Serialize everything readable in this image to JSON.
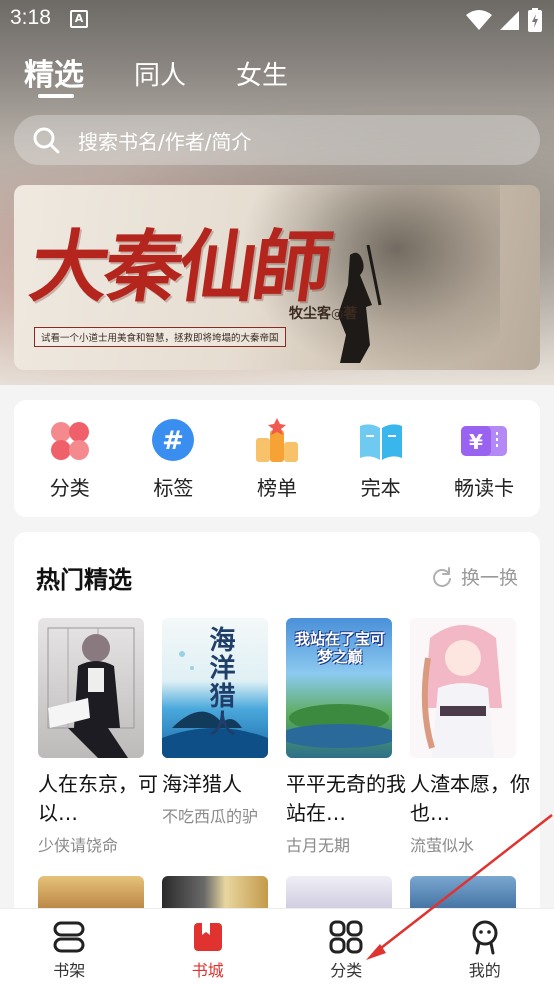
{
  "status_bar": {
    "time": "3:18",
    "indicator": "A"
  },
  "top_tabs": [
    {
      "label": "精选",
      "active": true
    },
    {
      "label": "同人",
      "active": false
    },
    {
      "label": "女生",
      "active": false
    }
  ],
  "search": {
    "placeholder": "搜索书名/作者/简介"
  },
  "banner": {
    "title": "大秦仙師",
    "author": "牧尘客◎著",
    "tagline": "试看一个小道士用美食和智慧，拯救即将垮塌的大秦帝国"
  },
  "categories": [
    {
      "label": "分类",
      "icon": "clover-icon",
      "color": "#f0606a"
    },
    {
      "label": "标签",
      "icon": "hashtag-icon",
      "color": "#3a8ef0"
    },
    {
      "label": "榜单",
      "icon": "podium-icon",
      "color": "#f7a234"
    },
    {
      "label": "完本",
      "icon": "open-book-icon",
      "color": "#39b6ec"
    },
    {
      "label": "畅读卡",
      "icon": "yen-card-icon",
      "color": "#9a62f0"
    }
  ],
  "hot": {
    "title": "热门精选",
    "refresh_label": "换一换",
    "books": [
      {
        "title": "人在东京，可以…",
        "author": "少侠请饶命",
        "cover_color": "#d8d6d6"
      },
      {
        "title": "海洋猎人",
        "author": "不吃西瓜的驴",
        "cover_color": "#9ad0e6",
        "cover_text": "海洋猎人"
      },
      {
        "title": "平平无奇的我站在…",
        "author": "古月无期",
        "cover_color": "#5aa0e0",
        "cover_text": "我站在了宝可梦之巅"
      },
      {
        "title": "人渣本愿，你也…",
        "author": "流萤似水",
        "cover_color": "#f3ecee"
      }
    ]
  },
  "bottom_nav": [
    {
      "label": "书架",
      "icon": "bookshelf-icon",
      "active": false
    },
    {
      "label": "书城",
      "icon": "bookstore-icon",
      "active": true
    },
    {
      "label": "分类",
      "icon": "grid-icon",
      "active": false
    },
    {
      "label": "我的",
      "icon": "profile-icon",
      "active": false
    }
  ],
  "colors": {
    "accent": "#e0322e",
    "arrow": "#e0322e"
  }
}
